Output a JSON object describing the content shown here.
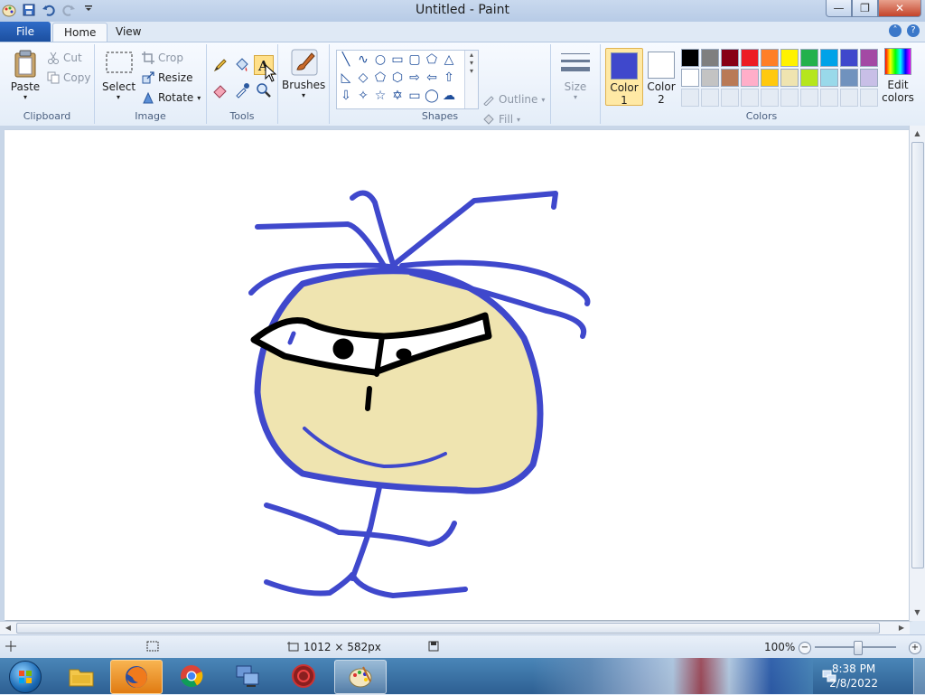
{
  "window": {
    "title": "Untitled - Paint",
    "minimize": "—",
    "maximize": "❐",
    "close": "✕"
  },
  "tabs": {
    "file": "File",
    "home": "Home",
    "view": "View"
  },
  "ribbon": {
    "clipboard": {
      "label": "Clipboard",
      "paste": "Paste",
      "cut": "Cut",
      "copy": "Copy"
    },
    "image": {
      "label": "Image",
      "select": "Select",
      "crop": "Crop",
      "resize": "Resize",
      "rotate": "Rotate"
    },
    "tools": {
      "label": "Tools",
      "active_tool": "text"
    },
    "brushes": {
      "label": "Brushes"
    },
    "shapes": {
      "label": "Shapes",
      "outline": "Outline",
      "fill": "Fill"
    },
    "size": {
      "label": "Size"
    },
    "colors": {
      "label": "Colors",
      "color1_label": "Color",
      "color1_num": "1",
      "color1_value": "#3f48cc",
      "color2_label": "Color",
      "color2_num": "2",
      "color2_value": "#ffffff",
      "edit_colors_line1": "Edit",
      "edit_colors_line2": "colors",
      "palette_row1": [
        "#000000",
        "#7f7f7f",
        "#880015",
        "#ed1c24",
        "#ff7f27",
        "#fff200",
        "#22b14c",
        "#00a2e8",
        "#3f48cc",
        "#a349a4"
      ],
      "palette_row2": [
        "#ffffff",
        "#c3c3c3",
        "#b97a57",
        "#ffaec9",
        "#ffc90e",
        "#efe4b0",
        "#b5e61d",
        "#99d9ea",
        "#7092be",
        "#c8bfe7"
      ]
    }
  },
  "canvas": {
    "face_fill": "#efe4b0",
    "stroke_blue": "#3f48cc",
    "stroke_black": "#000000"
  },
  "status": {
    "canvas_size": "1012 × 582px",
    "zoom": "100%"
  },
  "taskbar": {
    "time": "8:38 PM",
    "date": "2/8/2022"
  }
}
